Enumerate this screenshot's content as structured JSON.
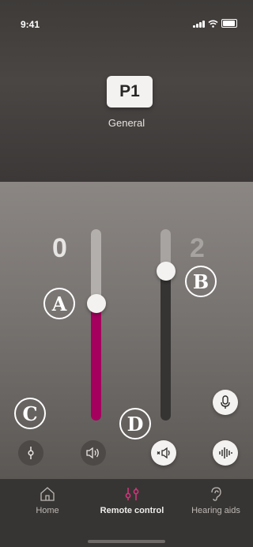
{
  "status_bar": {
    "time": "9:41"
  },
  "program": {
    "code": "P1",
    "name": "General"
  },
  "sliders": {
    "left_value": "0",
    "right_value": "2"
  },
  "callouts": {
    "a": "A",
    "b": "B",
    "c": "C",
    "d": "D"
  },
  "buttons": {
    "focus_icon": "focus-icon",
    "speaker_icon": "speaker-icon",
    "mute_icon": "mute-speaker-icon",
    "mic_icon": "microphone-icon",
    "wave_icon": "sound-wave-icon"
  },
  "tabs": {
    "home": "Home",
    "remote": "Remote control",
    "hearing": "Hearing aids"
  },
  "colors": {
    "accent": "#a5005e"
  }
}
